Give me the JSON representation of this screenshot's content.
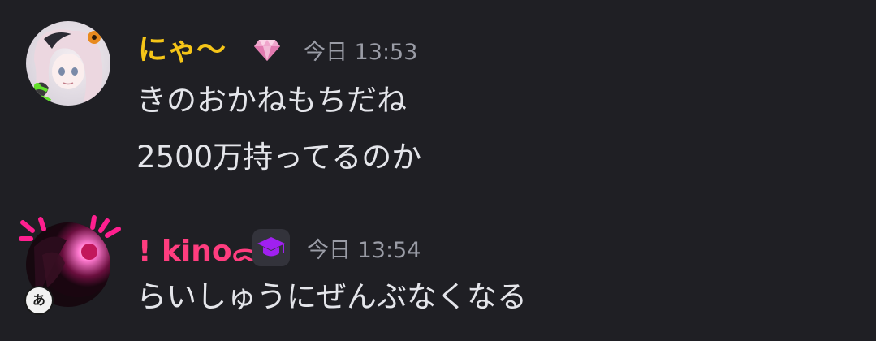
{
  "messages": [
    {
      "username": "にゃ〜",
      "name_color": "#f5c518",
      "badge_icon": "gem-icon",
      "time": "今日 13:53",
      "lines": [
        "きのおかねもちだね",
        "2500万持ってるのか"
      ]
    },
    {
      "username": "! kino",
      "name_suffix": "ᯅ",
      "name_color": "#ff3d7f",
      "badge_icon": "graduation-cap-icon",
      "time": "今日 13:54",
      "lines": [
        "らいしゅうにぜんぶなくなる"
      ],
      "avatar_decoration": "あ"
    }
  ]
}
